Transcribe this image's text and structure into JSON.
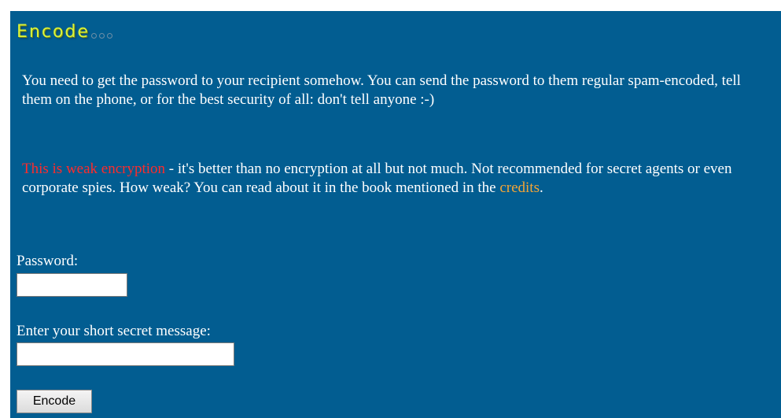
{
  "page": {
    "title": "Encode"
  },
  "intro": {
    "text": "You need to get the password to your recipient somehow. You can send the password to them regular spam-encoded, tell them on the phone, or for the best security of all: don't tell anyone :-)"
  },
  "warning": {
    "highlight": "This is weak encryption",
    "text_before_link": " - it's better than no encryption at all but not much. Not recommended for secret agents or even corporate spies. How weak? You can read about it in the book mentioned in the ",
    "link_label": "credits",
    "text_after_link": "."
  },
  "form": {
    "password_label": "Password:",
    "password_value": "",
    "message_label": "Enter your short secret message:",
    "message_value": "",
    "submit_label": "Encode"
  },
  "colors": {
    "panel_background": "#025d91",
    "title": "#d9f23a",
    "warning": "#ff2b2b",
    "link": "#f3a536"
  }
}
